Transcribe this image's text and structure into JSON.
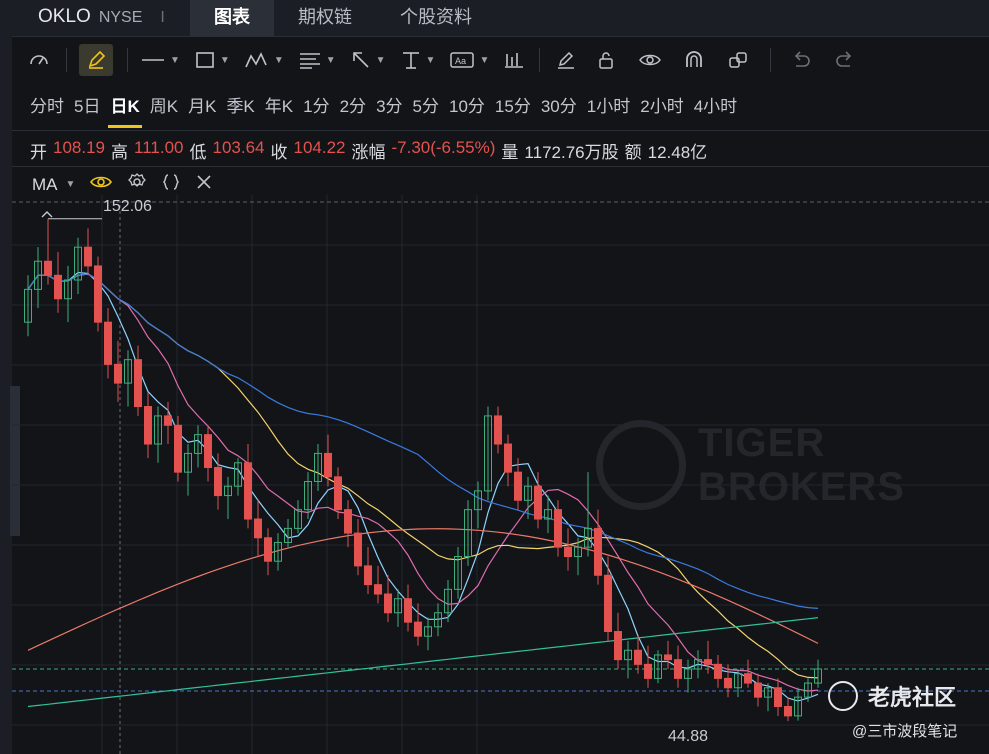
{
  "header": {
    "ticker": "OKLO",
    "exchange": "NYSE",
    "divider": "I",
    "tabs": [
      "图表",
      "期权链",
      "个股资料"
    ]
  },
  "toolbar": {
    "icons": [
      "speedometer-icon",
      "pencil-icon",
      "line-icon",
      "rectangle-icon",
      "zigzag-icon",
      "fib-icon",
      "arrow-icon",
      "measure-icon",
      "text-icon",
      "bars-icon",
      "marker-icon",
      "lock-icon",
      "eye-icon",
      "magnet-icon",
      "link-icon",
      "undo-icon",
      "redo-icon"
    ]
  },
  "periods": [
    "分时",
    "5日",
    "日K",
    "周K",
    "月K",
    "季K",
    "年K",
    "1分",
    "2分",
    "3分",
    "5分",
    "10分",
    "15分",
    "30分",
    "1小时",
    "2小时",
    "4小时"
  ],
  "active_period": "日K",
  "quote": {
    "open_label": "开",
    "open": "108.19",
    "high_label": "高",
    "high": "111.00",
    "low_label": "低",
    "low": "103.64",
    "close_label": "收",
    "close": "104.22",
    "change_label": "涨幅",
    "change": "-7.30(-6.55%)",
    "volume_label": "量",
    "volume": "1172.76万股",
    "amount_label": "额",
    "amount": "12.48亿"
  },
  "indicator": {
    "name": "MA"
  },
  "chart_labels": {
    "high_mark": "152.06",
    "low_mark": "44.88"
  },
  "watermark": {
    "line1": "TIGER",
    "line2": "BROKERS"
  },
  "brand": {
    "name": "老虎社区",
    "author": "@三市波段笔记"
  },
  "colors": {
    "up": "#3fae7a",
    "down": "#e3524f",
    "accent": "#f0c419",
    "ma5": "#8fd3ff",
    "ma10": "#e06cae",
    "ma20": "#f3d36b",
    "ma60": "#3a7be0",
    "ma120": "#ec7a6a",
    "ma250": "#31c19a"
  },
  "chart_data": {
    "type": "candlestick",
    "y_range_visible": [
      40,
      155
    ],
    "candles": [
      [
        130,
        140,
        127,
        137
      ],
      [
        137,
        146,
        133,
        143
      ],
      [
        143,
        152.06,
        138,
        140
      ],
      [
        140,
        145,
        132,
        135
      ],
      [
        135,
        142,
        130,
        139
      ],
      [
        139,
        148,
        136,
        146
      ],
      [
        146,
        150,
        140,
        142
      ],
      [
        142,
        144,
        128,
        130
      ],
      [
        130,
        133,
        118,
        121
      ],
      [
        121,
        126,
        113,
        117
      ],
      [
        117,
        124,
        112,
        122
      ],
      [
        122,
        125,
        110,
        112
      ],
      [
        112,
        115,
        101,
        104
      ],
      [
        104,
        112,
        100,
        110
      ],
      [
        110,
        113,
        104,
        108
      ],
      [
        108,
        110,
        96,
        98
      ],
      [
        98,
        104,
        93,
        102
      ],
      [
        102,
        108,
        99,
        106
      ],
      [
        106,
        108,
        96,
        99
      ],
      [
        99,
        102,
        90,
        93
      ],
      [
        93,
        97,
        88,
        95
      ],
      [
        95,
        101,
        93,
        100
      ],
      [
        100,
        104,
        86,
        88
      ],
      [
        88,
        92,
        80,
        84
      ],
      [
        84,
        86,
        76,
        79
      ],
      [
        79,
        85,
        77,
        83
      ],
      [
        83,
        88,
        82,
        86
      ],
      [
        86,
        92,
        85,
        90
      ],
      [
        90,
        98,
        88,
        96
      ],
      [
        96,
        104,
        94,
        102
      ],
      [
        102,
        106,
        95,
        97
      ],
      [
        97,
        99,
        88,
        90
      ],
      [
        90,
        92,
        82,
        85
      ],
      [
        85,
        88,
        76,
        78
      ],
      [
        78,
        82,
        72,
        74
      ],
      [
        74,
        78,
        70,
        72
      ],
      [
        72,
        76,
        66,
        68
      ],
      [
        68,
        73,
        65,
        71
      ],
      [
        71,
        74,
        64,
        66
      ],
      [
        66,
        70,
        61,
        63
      ],
      [
        63,
        67,
        60,
        65
      ],
      [
        65,
        70,
        63,
        68
      ],
      [
        68,
        75,
        66,
        73
      ],
      [
        73,
        82,
        71,
        80
      ],
      [
        80,
        92,
        78,
        90
      ],
      [
        90,
        96,
        86,
        94
      ],
      [
        94,
        112,
        92,
        110
      ],
      [
        110,
        112,
        102,
        104
      ],
      [
        104,
        106,
        95,
        98
      ],
      [
        98,
        101,
        90,
        92
      ],
      [
        92,
        97,
        88,
        95
      ],
      [
        95,
        98,
        86,
        88
      ],
      [
        88,
        93,
        85,
        90
      ],
      [
        90,
        92,
        80,
        82
      ],
      [
        82,
        86,
        77,
        80
      ],
      [
        80,
        84,
        76,
        82
      ],
      [
        82,
        98,
        80,
        86
      ],
      [
        86,
        90,
        74,
        76
      ],
      [
        76,
        80,
        62,
        64
      ],
      [
        64,
        68,
        56,
        58
      ],
      [
        58,
        62,
        54,
        60
      ],
      [
        60,
        63,
        55,
        57
      ],
      [
        57,
        61,
        52,
        54
      ],
      [
        54,
        60,
        53,
        59
      ],
      [
        59,
        62,
        56,
        58
      ],
      [
        58,
        61,
        52,
        54
      ],
      [
        54,
        58,
        51,
        56
      ],
      [
        56,
        60,
        54,
        58
      ],
      [
        58,
        62,
        55,
        57
      ],
      [
        57,
        59,
        52,
        54
      ],
      [
        54,
        57,
        50,
        52
      ],
      [
        52,
        56,
        50,
        55
      ],
      [
        55,
        58,
        52,
        53
      ],
      [
        53,
        55,
        48,
        50
      ],
      [
        50,
        53,
        47,
        52
      ],
      [
        52,
        54,
        46,
        48
      ],
      [
        48,
        50,
        44.88,
        46
      ],
      [
        46,
        52,
        45,
        50
      ],
      [
        50,
        54,
        49,
        53
      ],
      [
        53,
        58,
        52,
        56
      ]
    ]
  }
}
